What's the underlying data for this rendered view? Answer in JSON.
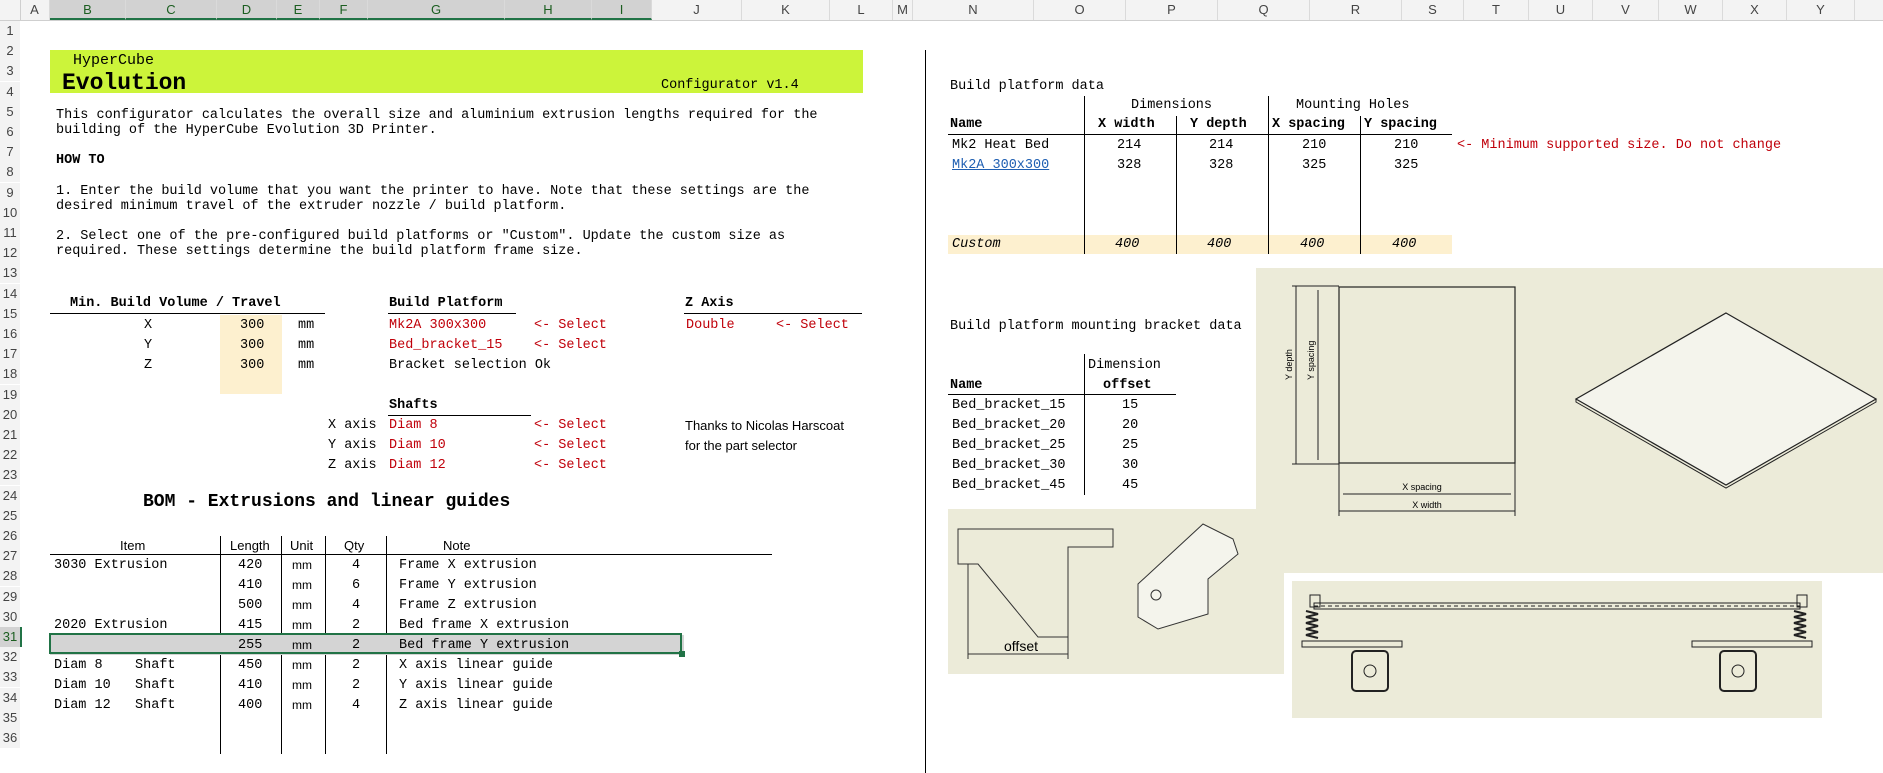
{
  "columns": [
    "A",
    "B",
    "C",
    "D",
    "E",
    "F",
    "G",
    "H",
    "I",
    "J",
    "K",
    "L",
    "M",
    "N",
    "O",
    "P",
    "Q",
    "R",
    "S",
    "T",
    "U",
    "V",
    "W",
    "X",
    "Y"
  ],
  "rows": [
    "1",
    "2",
    "3",
    "4",
    "5",
    "6",
    "7",
    "8",
    "9",
    "10",
    "11",
    "12",
    "13",
    "14",
    "15",
    "16",
    "17",
    "18",
    "19",
    "20",
    "21",
    "22",
    "23",
    "24",
    "25",
    "26",
    "27",
    "28",
    "29",
    "30",
    "31",
    "32",
    "33",
    "34",
    "35",
    "36"
  ],
  "banner": {
    "subtitle": "HyperCube",
    "title": "Evolution",
    "version": "Configurator v1.4"
  },
  "intro": {
    "line1": "This configurator calculates the overall size and aluminium extrusion lengths required for the",
    "line2": "building of the HyperCube Evolution 3D Printer.",
    "howto": "HOW TO",
    "step1a": "1. Enter the build volume that you want the printer to have. Note that these settings are the",
    "step1b": "desired minimum travel of the extruder nozzle / build platform.",
    "step2a": "2. Select one of the pre-configured build platforms or \"Custom\". Update the custom size as",
    "step2b": "required. These settings determine the build platform frame size."
  },
  "build_volume": {
    "header": "Min. Build Volume / Travel",
    "rows": [
      {
        "axis": "X",
        "value": "300",
        "unit": "mm"
      },
      {
        "axis": "Y",
        "value": "300",
        "unit": "mm"
      },
      {
        "axis": "Z",
        "value": "300",
        "unit": "mm"
      }
    ]
  },
  "build_platform": {
    "header": "Build Platform",
    "platform": "Mk2A 300x300",
    "bracket": "Bed_bracket_15",
    "select": "<- Select",
    "status": "Bracket selection Ok"
  },
  "z_axis": {
    "header": "Z Axis",
    "value": "Double",
    "select": "<- Select"
  },
  "shafts": {
    "header": "Shafts",
    "rows": [
      {
        "axis": "X axis",
        "value": "Diam 8",
        "select": "<- Select"
      },
      {
        "axis": "Y axis",
        "value": "Diam 10",
        "select": "<- Select"
      },
      {
        "axis": "Z axis",
        "value": "Diam 12",
        "select": "<- Select"
      }
    ],
    "thanks1": "Thanks to Nicolas Harscoat",
    "thanks2": "for the part selector"
  },
  "bom": {
    "title": "BOM - Extrusions and linear guides",
    "headers": {
      "item": "Item",
      "length": "Length",
      "unit": "Unit",
      "qty": "Qty",
      "note": "Note"
    },
    "rows": [
      {
        "item": "3030 Extrusion",
        "length": "420",
        "unit": "mm",
        "qty": "4",
        "note": "Frame X extrusion"
      },
      {
        "item": "",
        "length": "410",
        "unit": "mm",
        "qty": "6",
        "note": "Frame Y extrusion"
      },
      {
        "item": "",
        "length": "500",
        "unit": "mm",
        "qty": "4",
        "note": "Frame Z extrusion"
      },
      {
        "item": "2020 Extrusion",
        "length": "415",
        "unit": "mm",
        "qty": "2",
        "note": "Bed frame X extrusion"
      },
      {
        "item": "",
        "length": "255",
        "unit": "mm",
        "qty": "2",
        "note": "Bed frame Y extrusion"
      },
      {
        "item": "Diam 8    Shaft",
        "length": "450",
        "unit": "mm",
        "qty": "2",
        "note": "X axis linear guide"
      },
      {
        "item": "Diam 10   Shaft",
        "length": "410",
        "unit": "mm",
        "qty": "2",
        "note": "Y axis linear guide"
      },
      {
        "item": "Diam 12   Shaft",
        "length": "400",
        "unit": "mm",
        "qty": "4",
        "note": "Z axis linear guide"
      }
    ]
  },
  "platform_data": {
    "title": "Build platform data",
    "group_dims": "Dimensions",
    "group_holes": "Mounting Holes",
    "headers": {
      "name": "Name",
      "xw": "X width",
      "yd": "Y depth",
      "xs": "X spacing",
      "ys": "Y spacing"
    },
    "rows": [
      {
        "name": "Mk2 Heat Bed",
        "xw": "214",
        "yd": "214",
        "xs": "210",
        "ys": "210"
      },
      {
        "name": "Mk2A 300x300",
        "xw": "328",
        "yd": "328",
        "xs": "325",
        "ys": "325"
      }
    ],
    "custom": {
      "name": "Custom",
      "xw": "400",
      "yd": "400",
      "xs": "400",
      "ys": "400"
    },
    "note": "<- Minimum supported size. Do not change"
  },
  "bracket_data": {
    "title": "Build platform mounting bracket data",
    "headers": {
      "name": "Name",
      "dim1": "Dimension",
      "dim2": "offset"
    },
    "rows": [
      {
        "name": "Bed_bracket_15",
        "offset": "15"
      },
      {
        "name": "Bed_bracket_20",
        "offset": "20"
      },
      {
        "name": "Bed_bracket_25",
        "offset": "25"
      },
      {
        "name": "Bed_bracket_30",
        "offset": "30"
      },
      {
        "name": "Bed_bracket_45",
        "offset": "45"
      }
    ]
  },
  "diagram_labels": {
    "y_depth": "Y depth",
    "y_spacing": "Y spacing",
    "x_spacing": "X spacing",
    "x_width": "X width",
    "offset": "offset"
  },
  "colors": {
    "banner": "#ccf43a",
    "input": "#fdf0cf",
    "red": "#c0000a",
    "link": "#1f5fb2",
    "excel_green": "#217346",
    "drawing_bg": "#ecebd9"
  }
}
